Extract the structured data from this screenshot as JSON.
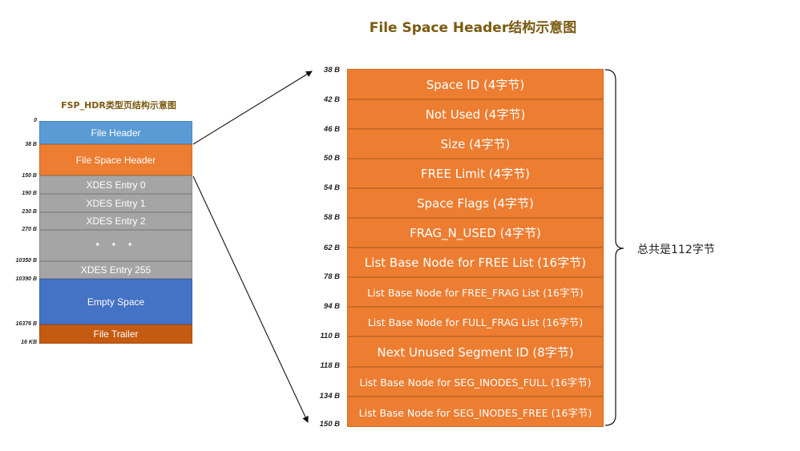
{
  "main_title": "File Space Header结构示意图",
  "left_title": "FSP_HDR类型页结构示意图",
  "left_blocks": [
    {
      "label": "File Header"
    },
    {
      "label": "File Space Header"
    },
    {
      "label": "XDES Entry 0"
    },
    {
      "label": "XDES Entry 1"
    },
    {
      "label": "XDES Entry 2"
    },
    {
      "label": "· · ·"
    },
    {
      "label": "XDES Entry 255"
    },
    {
      "label": "Empty Space"
    },
    {
      "label": "File Trailer"
    }
  ],
  "left_offsets": [
    "0",
    "38 B",
    "150 B",
    "190 B",
    "230 B",
    "270 B",
    "10350 B",
    "10390 B",
    "16376 B",
    "16 KB"
  ],
  "right_fields": [
    {
      "label": "Space ID (4字节)"
    },
    {
      "label": "Not Used (4字节)"
    },
    {
      "label": "Size (4字节)"
    },
    {
      "label": "FREE Limit (4字节)"
    },
    {
      "label": "Space Flags (4字节)"
    },
    {
      "label": "FRAG_N_USED (4字节)"
    },
    {
      "label": "List Base Node for FREE List (16字节)"
    },
    {
      "label": "List Base Node for FREE_FRAG List (16字节)"
    },
    {
      "label": "List Base Node for FULL_FRAG List (16字节)"
    },
    {
      "label": "Next Unused Segment ID  (8字节)"
    },
    {
      "label": "List Base Node for SEG_INODES_FULL (16字节)"
    },
    {
      "label": "List Base Node for SEG_INODES_FREE (16字节)"
    }
  ],
  "right_offsets": [
    "38 B",
    "42 B",
    "46 B",
    "50 B",
    "54 B",
    "58 B",
    "62 B",
    "78 B",
    "94 B",
    "110 B",
    "118 B",
    "134 B",
    "150 B"
  ],
  "total_label": "总共是112字节",
  "colors": {
    "orange": "#ed7d31",
    "light_blue": "#5b9bd5",
    "gray": "#a5a5a5",
    "blue": "#4472c4",
    "dark_orange": "#c55a11",
    "title_brown": "#7a5a10"
  }
}
